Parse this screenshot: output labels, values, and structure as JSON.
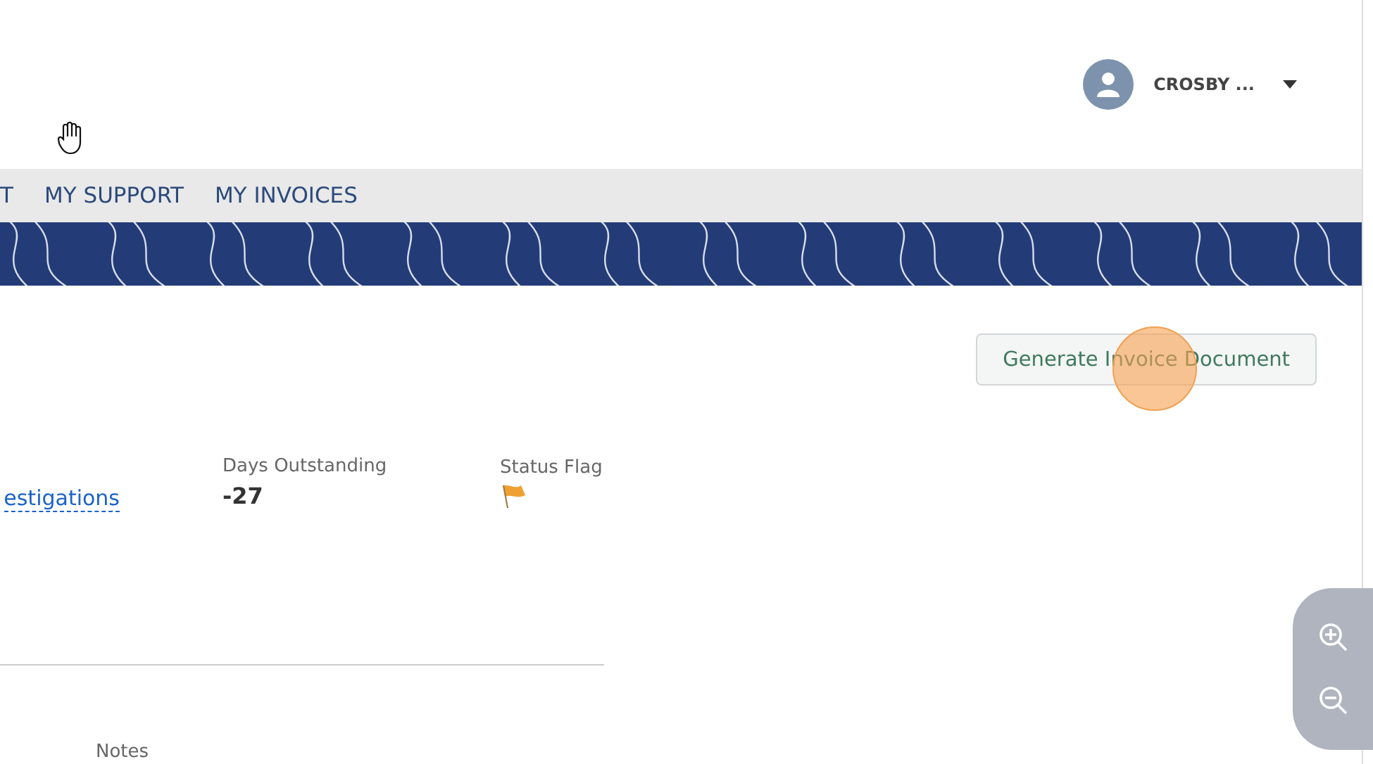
{
  "header": {
    "user_name": "CROSBY ..."
  },
  "nav": {
    "items": [
      {
        "label": "T"
      },
      {
        "label": "MY SUPPORT"
      },
      {
        "label": "MY INVOICES"
      }
    ]
  },
  "actions": {
    "buttons": [
      "Generate Invoice Document"
    ]
  },
  "fields": [
    {
      "kind": "link",
      "value": "estigations"
    },
    {
      "kind": "text",
      "label": "Days Outstanding",
      "value": "-27"
    },
    {
      "kind": "flag",
      "label": "Status Flag"
    }
  ],
  "notes": {
    "label": "Notes"
  }
}
